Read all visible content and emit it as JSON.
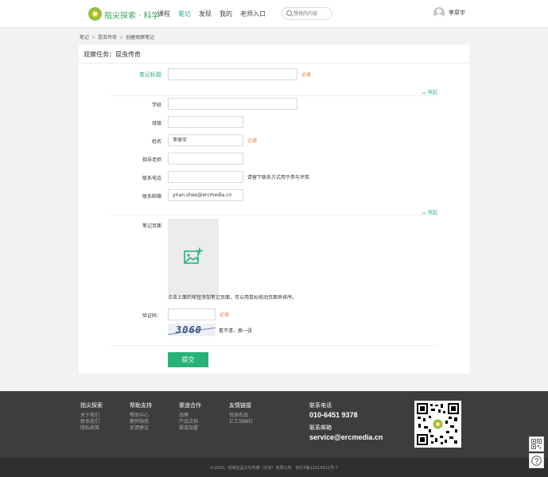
{
  "header": {
    "brand": "指尖探索 · 科学",
    "nav": [
      "课程",
      "笔记",
      "发现",
      "我的",
      "老师入口"
    ],
    "active_nav": "笔记",
    "search_placeholder": "想找的内容",
    "username": "李原宇"
  },
  "breadcrumb": [
    "笔记",
    "昆虫传奇",
    "创建观察笔记"
  ],
  "card": {
    "title": "观察任务：昆虫传奇",
    "collapse_label": "︽ 收起",
    "fields": {
      "note_title": {
        "label": "笔记标题",
        "value": "",
        "required": "必填"
      },
      "school": {
        "label": "学校",
        "value": ""
      },
      "class": {
        "label": "班级",
        "value": ""
      },
      "name": {
        "label": "姓名",
        "value": "李原宇",
        "required": "必填"
      },
      "teacher": {
        "label": "指导老师",
        "value": ""
      },
      "phone": {
        "label": "联系电话",
        "value": "",
        "hint": "请留下联系方式用于参与评奖"
      },
      "email": {
        "label": "联系邮箱",
        "value": "yiran.shao@ercmedia.cn"
      },
      "pages": {
        "label": "笔记页面",
        "hint": "点击上面的按钮添加笔记页面，可以用鼠标拖动页面来排序。"
      },
      "captcha": {
        "label": "验证码：",
        "value": "",
        "required": "必填",
        "image_text": "3060",
        "refresh": "看不清，换一张"
      }
    },
    "submit": "提交"
  },
  "footer": {
    "columns": [
      {
        "title": "指尖探索",
        "items": [
          "关于我们",
          "联系我们",
          "隐私政策"
        ]
      },
      {
        "title": "帮助支持",
        "items": [
          "帮助中心",
          "教师指南",
          "反馈建议"
        ]
      },
      {
        "title": "渠道合作",
        "items": [
          "品牌",
          "产品文档",
          "渠道加盟"
        ]
      },
      {
        "title": "友情链接",
        "items": [
          "悦读名品",
          "亿工动画社"
        ]
      }
    ],
    "phone_label": "联系电话",
    "phone": "010-6451 9378",
    "email_label": "联系邮箱",
    "email": "service@ercmedia.cn",
    "copyright": "©2016，悦读名品文化传媒（北京）有限公司　京ICP备11010011号-7"
  },
  "colors": {
    "accent": "#27b27a",
    "required": "#e8803a",
    "footer": "#3d3d3d"
  },
  "icons": [
    "logo-icon",
    "search-icon",
    "avatar",
    "upload-image-icon",
    "qr-code",
    "qr-side-icon",
    "help-icon"
  ]
}
